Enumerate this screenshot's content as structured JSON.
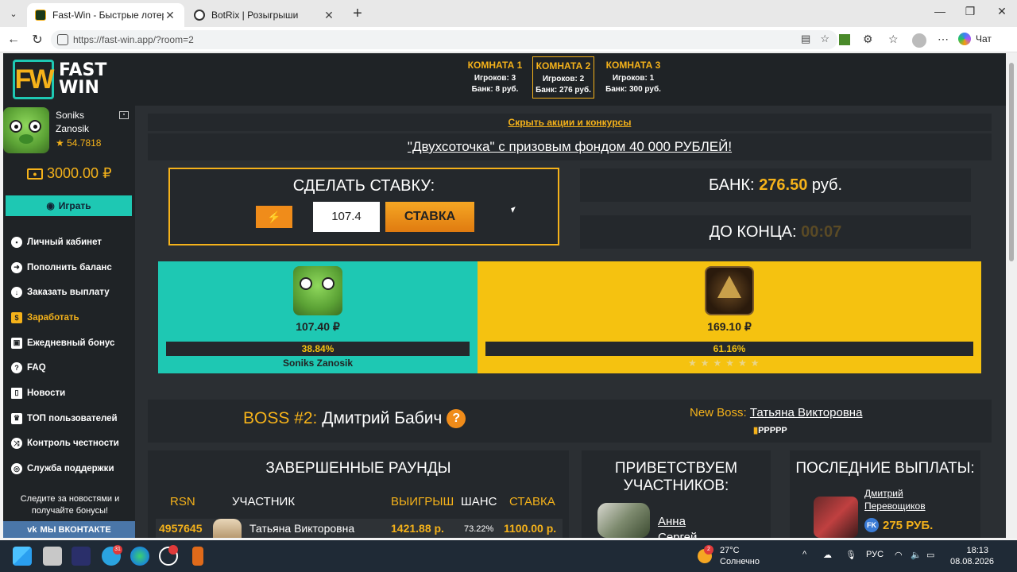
{
  "browser": {
    "tabs": [
      {
        "title": "Fast-Win - Быстрые лотереи! Ком",
        "active": true
      },
      {
        "title": "BotRix | Розыгрыши",
        "active": false
      }
    ],
    "url": "https://fast-win.app/?room=2",
    "chat_label": "Чат"
  },
  "logo": {
    "mark": "FW",
    "line1": "FAST",
    "line2": "WIN"
  },
  "rooms": [
    {
      "name": "КОМНАТА 1",
      "players": "Игроков: 3",
      "bank": "Банк: 8 руб.",
      "active": false
    },
    {
      "name": "КОМНАТА 2",
      "players": "Игроков: 2",
      "bank": "Банк: 276 руб.",
      "active": true
    },
    {
      "name": "КОМНАТА 3",
      "players": "Игроков: 1",
      "bank": "Банк: 300 руб.",
      "active": false
    }
  ],
  "user": {
    "name": "Soniks Zanosik",
    "rating": "★ 54.7818",
    "balance": "3000.00 ₽",
    "play_label": "Играть"
  },
  "menu": [
    {
      "label": "Личный кабинет",
      "icon": "briefcase-icon"
    },
    {
      "label": "Пополнить баланс",
      "icon": "arrow-right-circle-icon"
    },
    {
      "label": "Заказать выплату",
      "icon": "arrow-down-circle-icon"
    },
    {
      "label": "Заработать",
      "icon": "money-icon"
    },
    {
      "label": "Ежедневный бонус",
      "icon": "gift-icon"
    },
    {
      "label": "FAQ",
      "icon": "question-icon"
    },
    {
      "label": "Новости",
      "icon": "bookmark-icon"
    },
    {
      "label": "ТОП пользователей",
      "icon": "trophy-icon"
    },
    {
      "label": "Контроль честности",
      "icon": "shuffle-icon"
    },
    {
      "label": "Служба поддержки",
      "icon": "support-icon"
    }
  ],
  "news_text": "Следите за новостями и получайте бонусы!",
  "vk_label": "МЫ ВКОНТАКТЕ",
  "banners": {
    "hide_promos": "Скрыть акции и конкурсы",
    "contest": "\"Двухсоточка\" с призовым фондом 40 000 РУБЛЕЙ!"
  },
  "bet": {
    "title": "СДЕЛАТЬ СТАВКУ:",
    "bolt": "⚡",
    "value": "107.4",
    "submit": "СТАВКА"
  },
  "bank": {
    "label": "БАНК:",
    "value": "276.50",
    "unit": "руб."
  },
  "timer": {
    "label": "ДО КОНЦА:",
    "value": "00:07"
  },
  "game": {
    "players": [
      {
        "amount": "107.40 ₽",
        "percent": "38.84%",
        "share": 0.3884,
        "name": "Soniks Zanosik",
        "color": "#1ec8b3"
      },
      {
        "amount": "169.10 ₽",
        "percent": "61.16%",
        "share": 0.6116,
        "name": "",
        "color": "#f5c210"
      }
    ],
    "stars": "★★★★★★"
  },
  "boss": {
    "label": "BOSS #2:",
    "name": "Дмитрий Бабич",
    "help": "?",
    "new_label": "New Boss:",
    "new_name": "Татьяна Викторовна",
    "flags": "PPPPP"
  },
  "rounds": {
    "title": "ЗАВЕРШЕННЫЕ РАУНДЫ",
    "headers": [
      "RSN",
      "УЧАСТНИК",
      "ВЫИГРЫШ",
      "ШАНС",
      "СТАВКА"
    ],
    "rows": [
      {
        "rsn": "4957645",
        "user": "Татьяна Викторовна",
        "win": "1421.88 р.",
        "chance": "73.22%",
        "bet": "1100.00 р."
      }
    ]
  },
  "greet": {
    "title": "ПРИВЕТСТВУЕМ УЧАСТНИКОВ:",
    "name": "Анна Сергей"
  },
  "payouts": {
    "title": "ПОСЛЕДНИЕ ВЫПЛАТЫ:",
    "name": "Дмитрий Перевощиков",
    "amount": "275 РУБ."
  },
  "taskbar": {
    "telegram_badge": "31",
    "weather_badge": "2",
    "temp": "27°C",
    "weather": "Солнечно",
    "lang": "РУС",
    "time": "18:13",
    "date": "08.08.2026"
  }
}
